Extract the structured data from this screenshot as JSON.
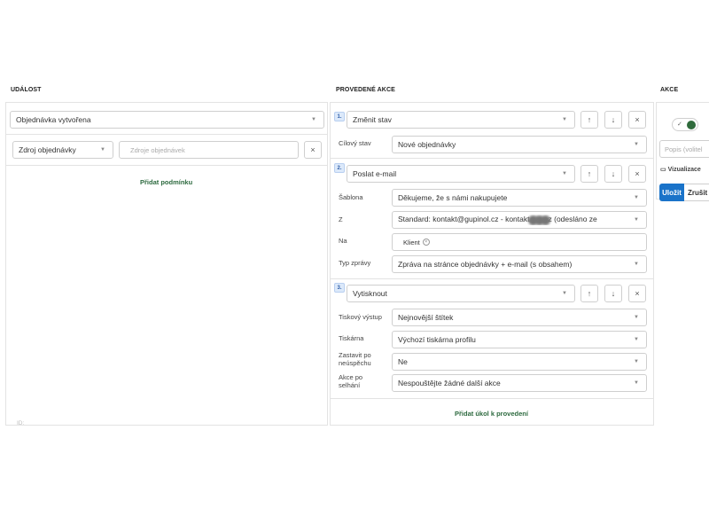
{
  "columns": {
    "event": "UDÁLOST",
    "execution": "PROVEDENÉ AKCE",
    "actions": "AKCE"
  },
  "event": {
    "trigger": "Objednávka vytvořena",
    "condition_field": "Zdroj objednávky",
    "condition_placeholder": "Zdroje objednávek",
    "remove_label": "×",
    "add_condition": "Přidat podmínku",
    "id_label": "ID:"
  },
  "steps": [
    {
      "number": "1.",
      "action": "Změnit stav",
      "fields": [
        {
          "label": "Cílový stav",
          "value": "Nové objednávky"
        }
      ]
    },
    {
      "number": "2.",
      "action": "Poslat e-mail",
      "fields": [
        {
          "label": "Šablona",
          "value": "Děkujeme, že s námi nakupujete"
        },
        {
          "label": "Z",
          "value_start": "Standard: kontakt@gupinol.cz - kontakt",
          "value_end": "z (odesláno ze"
        },
        {
          "label": "Na",
          "chip": "Klient"
        },
        {
          "label": "Typ zprávy",
          "value": "Zpráva na stránce objednávky + e-mail (s obsahem)"
        }
      ]
    },
    {
      "number": "3.",
      "action": "Vytisknout",
      "fields": [
        {
          "label": "Tiskový výstup",
          "value": "Nejnovější štítek"
        },
        {
          "label": "Tiskárna",
          "value": "Výchozí tiskárna profilu"
        },
        {
          "label": "Zastavit po neúspěchu",
          "label_line1": "Zastavit po",
          "label_line2": "neúspěchu",
          "value": "Ne"
        },
        {
          "label": "Akce po selhání",
          "label_line1": "Akce po",
          "label_line2": "selhání",
          "value": "Nespouštějte žádné další akce"
        }
      ]
    }
  ],
  "step_controls": {
    "up": "↑",
    "down": "↓",
    "remove": "×"
  },
  "add_task": "Přidat úkol k provedení",
  "actions_panel": {
    "toggle_check": "✓",
    "description_placeholder": "Popis (volitel",
    "visualization": "Vizualizace",
    "save": "Uložit",
    "cancel": "Zrušit"
  }
}
